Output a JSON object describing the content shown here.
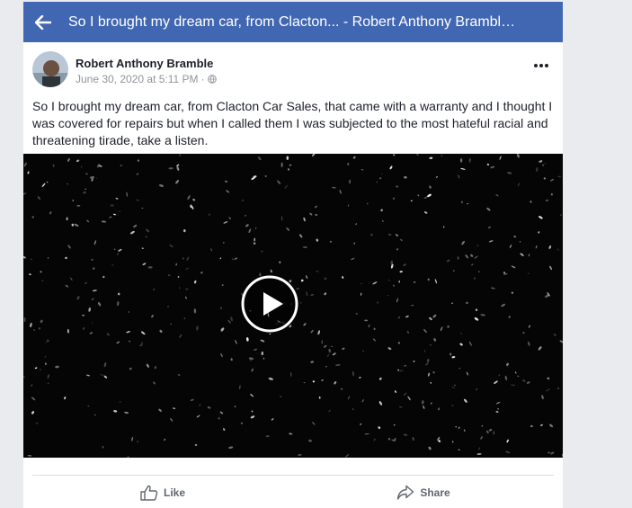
{
  "header": {
    "title": "So I brought my dream car, from Clacton... - Robert Anthony Brambl…"
  },
  "post": {
    "author": "Robert Anthony Bramble",
    "date": "June 30, 2020 at 5:11 PM",
    "separator": "·",
    "text": "So I brought my dream car, from Clacton Car Sales, that came with a warranty and I thought I was covered for repairs but when I called them I was subjected to the most hateful racial and threatening tirade, take a listen."
  },
  "actions": {
    "like_label": "Like",
    "share_label": "Share"
  },
  "icons": {
    "back": "back-arrow-icon",
    "more": "more-options-icon",
    "privacy": "globe-icon",
    "play": "play-icon",
    "like": "thumbs-up-icon",
    "share": "share-arrow-icon"
  },
  "colors": {
    "topbar": "#4267b2",
    "page_bg": "#e9ebee",
    "action_text": "#606770",
    "meta_text": "#90949c"
  }
}
